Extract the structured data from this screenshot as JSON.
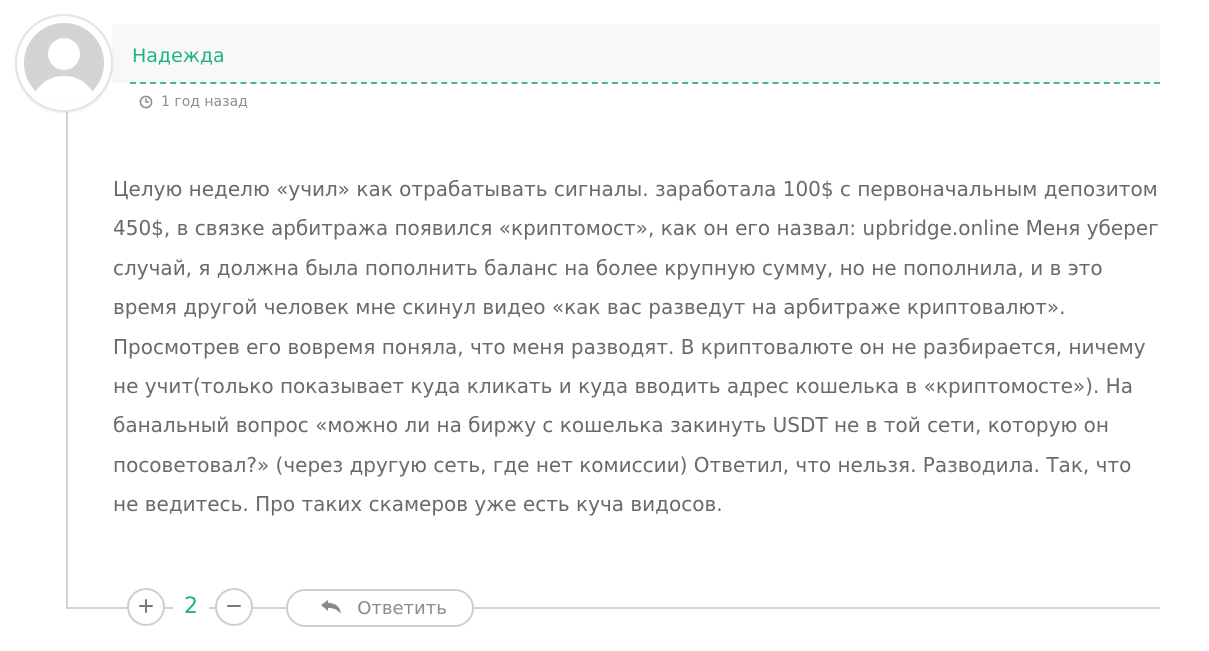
{
  "comment": {
    "author": "Надежда",
    "timestamp": "1 год назад",
    "text": "Целую неделю «учил» как отрабатывать сигналы. заработала 100$ с первоначальным депозитом 450$, в связке арбитража появился «криптомост», как он его назвал: upbridge.online Меня уберег случай, я должна была пополнить баланс на более крупную сумму, но не пополнила, и в это время другой человек мне скинул видео «как вас разведут на арбитраже криптовалют». Просмотрев его вовремя поняла, что меня разводят. В криптовалюте он не разбирается, ничему не учит(только показывает куда кликать и куда вводить адрес кошелька в «криптомосте»). На банальный вопрос «можно ли на биржу с кошелька закинуть USDT не в той сети, которую он посоветовал?» (через другую сеть, где нет комиссии) Ответил, что нельзя. Разводила. Так, что не ведитесь. Про таких скамеров уже есть куча видосов.",
    "votes": {
      "plus_icon": "plus-icon",
      "count": "2",
      "minus_icon": "minus-icon"
    },
    "reply": {
      "label": "Ответить",
      "icon": "reply-arrow-icon"
    }
  },
  "colors": {
    "accent": "#1db57c",
    "dashed_line": "#45b88a",
    "text": "#6a6a6a",
    "muted": "#8d8d8d",
    "border": "#cfcfcf"
  }
}
